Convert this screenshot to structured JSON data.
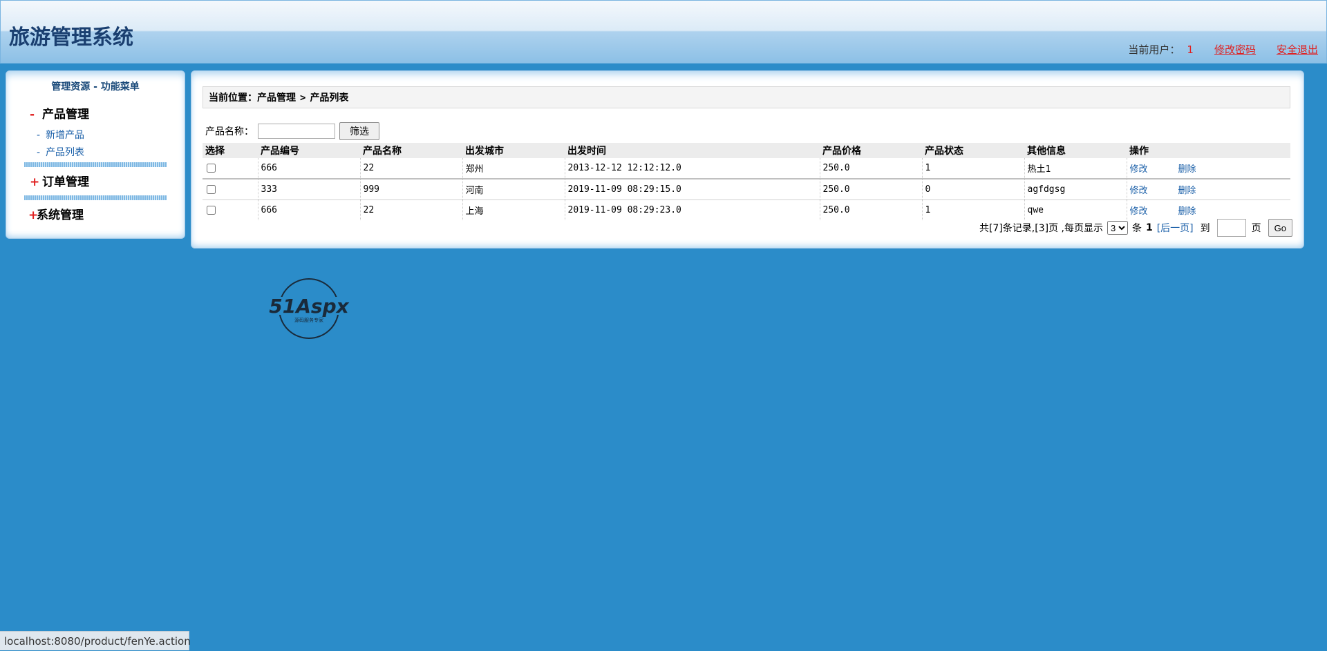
{
  "header": {
    "title": "旅游管理系统",
    "current_user_label": "当前用户：",
    "current_user_value": "1",
    "change_password": "修改密码",
    "logout": "安全退出"
  },
  "sidebar": {
    "title": "管理资源  - 功能菜单",
    "groups": [
      {
        "sign": "-",
        "label": "产品管理",
        "items": [
          "新增产品",
          "产品列表"
        ]
      },
      {
        "sign": "+",
        "label": "订单管理",
        "items": []
      },
      {
        "sign": "+",
        "label": "系统管理",
        "items": []
      }
    ]
  },
  "main": {
    "breadcrumb_prefix": "当前位置：产品管理",
    "breadcrumb_sep": ">",
    "breadcrumb_current": "产品列表",
    "filter_label": "产品名称：",
    "filter_value": "",
    "filter_button": "筛选",
    "columns": [
      "选择",
      "产品编号",
      "产品名称",
      "出发城市",
      "出发时间",
      "产品价格",
      "产品状态",
      "其他信息",
      "操作"
    ],
    "rows": [
      {
        "id": "666",
        "name": "22",
        "city": "郑州",
        "time": "2013-12-12 12:12:12.0",
        "price": "250.0",
        "status": "1",
        "info": "热土1"
      },
      {
        "id": "333",
        "name": "999",
        "city": "河南",
        "time": "2019-11-09 08:29:15.0",
        "price": "250.0",
        "status": "0",
        "info": "agfdgsg"
      },
      {
        "id": "666",
        "name": "22",
        "city": "上海",
        "time": "2019-11-09 08:29:23.0",
        "price": "250.0",
        "status": "1",
        "info": "qwe"
      }
    ],
    "edit_label": "修改",
    "delete_label": "删除",
    "pager": {
      "summary": "共[7]条记录,[3]页 ,每页显示",
      "page_size": "3",
      "page_size_unit": "条",
      "current_page": "1",
      "next_page": "[后一页]",
      "goto_label": "到",
      "page_unit": "页",
      "go_button": "Go"
    }
  },
  "logo": {
    "text": "51Aspx",
    "subtitle": "源码服务专家"
  },
  "statusbar": {
    "url": "localhost:8080/product/fenYe.action"
  }
}
